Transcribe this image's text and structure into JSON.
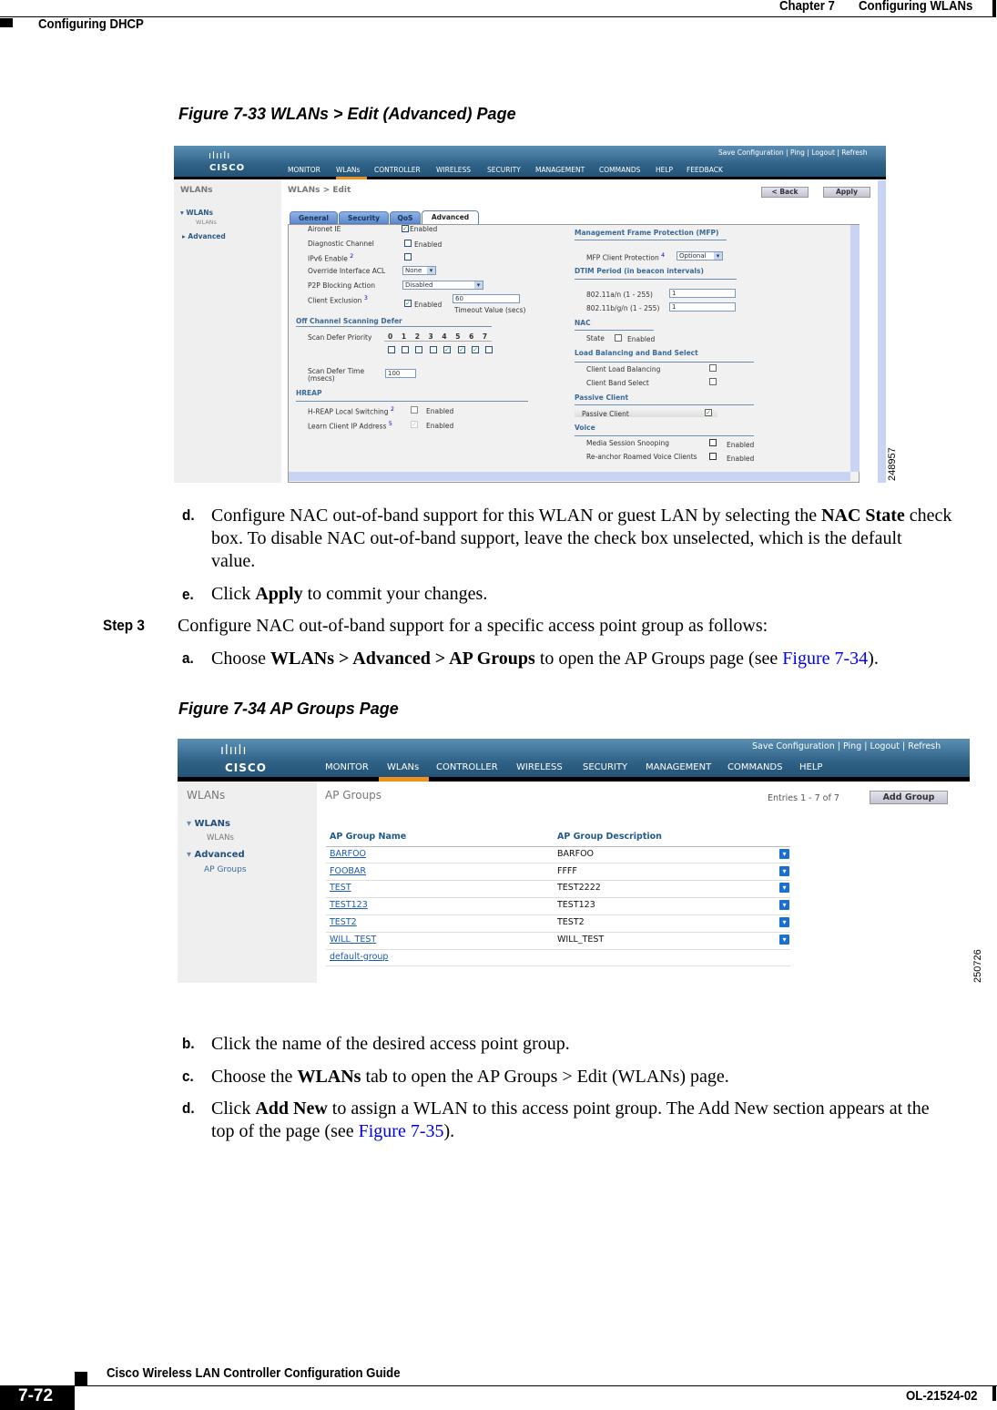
{
  "header": {
    "chapter": "Chapter 7",
    "chapter_title": "Configuring WLANs",
    "section": "Configuring DHCP"
  },
  "figure1": {
    "caption": "Figure 7-33   WLANs > Edit (Advanced) Page",
    "brand": "CISCO",
    "top_links": [
      "Save Configuration",
      "Ping",
      "Logout",
      "Refresh"
    ],
    "nav": [
      "MONITOR",
      "WLANs",
      "CONTROLLER",
      "WIRELESS",
      "SECURITY",
      "MANAGEMENT",
      "COMMANDS",
      "HELP",
      "FEEDBACK"
    ],
    "sidebar": {
      "title": "WLANs",
      "items": [
        "WLANs",
        "WLANs",
        "Advanced"
      ]
    },
    "page_title": "WLANs > Edit",
    "back": "< Back",
    "apply": "Apply",
    "tabs": [
      "General",
      "Security",
      "QoS",
      "Advanced"
    ],
    "left": {
      "aironet": "Aironet IE",
      "diag": "Diagnostic Channel",
      "ipv6": "IPv6 Enable",
      "acl": "Override Interface ACL",
      "acl_value": "None",
      "p2p": "P2P Blocking Action",
      "p2p_value": "Disabled",
      "excl": "Client Exclusion",
      "excl_timeout": "60",
      "timeout_label": "Timeout Value (secs)",
      "enabled": "Enabled",
      "fn2": "2",
      "fn3": "3",
      "fn5": "5",
      "ocsd": "Off Channel Scanning Defer",
      "sdp": "Scan Defer Priority",
      "priorities": [
        "0",
        "1",
        "2",
        "3",
        "4",
        "5",
        "6",
        "7"
      ],
      "sdt": "Scan Defer Time",
      "sdt2": "(msecs)",
      "sdt_value": "100",
      "hreap": "HREAP",
      "local_sw": "H-REAP Local Switching",
      "learn_ip": "Learn Client IP Address"
    },
    "right": {
      "mfp": "Management Frame Protection (MFP)",
      "mfp_client": "MFP Client Protection",
      "fn4": "4",
      "mfp_value": "Optional",
      "dtim": "DTIM Period (in beacon intervals)",
      "a_n": "802.11a/n (1 - 255)",
      "a_n_value": "1",
      "bgn": "802.11b/g/n (1 - 255)",
      "bgn_value": "1",
      "nac": "NAC",
      "state": "State",
      "enabled": "Enabled",
      "lb": "Load Balancing and Band Select",
      "clb": "Client Load Balancing",
      "cbs": "Client Band Select",
      "passive": "Passive Client",
      "passive_row": "Passive Client",
      "voice": "Voice",
      "mss": "Media Session Snooping",
      "reanchor": "Re-anchor Roamed Voice Clients"
    },
    "figure_id": "248957"
  },
  "steps1": {
    "d_marker": "d.",
    "d_l1a": "Configure NAC out-of-band support for this WLAN or guest LAN by selecting the ",
    "d_l1b": "NAC State",
    "d_l1c": " check",
    "d_l2": "box. To disable NAC out-of-band support, leave the check box unselected, which is the default",
    "d_l3": "value.",
    "e_marker": "e.",
    "e_a": "Click ",
    "e_b": "Apply",
    "e_c": " to commit your changes.",
    "step3": "Step 3",
    "step3_text": "Configure NAC out-of-band support for a specific access point group as follows:",
    "a_marker": "a.",
    "a_1": "Choose ",
    "a_2": "WLANs > Advanced > AP Groups",
    "a_3": " to open the AP Groups page (see ",
    "a_link": "Figure 7-34",
    "a_4": ")."
  },
  "figure2": {
    "caption": "Figure 7-34   AP Groups Page",
    "brand": "CISCO",
    "top_links": [
      "Save Configuration",
      "Ping",
      "Logout",
      "Refresh"
    ],
    "nav": [
      "MONITOR",
      "WLANs",
      "CONTROLLER",
      "WIRELESS",
      "SECURITY",
      "MANAGEMENT",
      "COMMANDS",
      "HELP"
    ],
    "sidebar": {
      "title": "WLANs",
      "items": [
        "WLANs",
        "WLANs",
        "Advanced",
        "AP Groups"
      ]
    },
    "page_title": "AP Groups",
    "entries": "Entries 1 - 7 of 7",
    "add_group": "Add Group",
    "columns": [
      "AP Group Name",
      "AP Group Description"
    ],
    "rows": [
      {
        "name": "BARFOO",
        "desc": "BARFOO"
      },
      {
        "name": "FOOBAR",
        "desc": "FFFF"
      },
      {
        "name": "TEST",
        "desc": "TEST2222"
      },
      {
        "name": "TEST123",
        "desc": "TEST123"
      },
      {
        "name": "TEST2",
        "desc": "TEST2"
      },
      {
        "name": "WILL_TEST",
        "desc": "WILL_TEST"
      },
      {
        "name": "default-group",
        "desc": ""
      }
    ],
    "figure_id": "250726"
  },
  "steps2": {
    "b_marker": "b.",
    "b_text": "Click the name of the desired access point group.",
    "c_marker": "c.",
    "c_1": "Choose the ",
    "c_2": "WLANs",
    "c_3": " tab to open the AP Groups > Edit (WLANs) page.",
    "d_marker": "d.",
    "d_1": "Click ",
    "d_2": "Add New",
    "d_3": " to assign a WLAN to this access point group. The Add New section appears at the",
    "d_4": "top of the page (see ",
    "d_link": "Figure 7-35",
    "d_5": ")."
  },
  "footer": {
    "guide": "Cisco Wireless LAN Controller Configuration Guide",
    "page": "7-72",
    "doc": "OL-21524-02"
  }
}
